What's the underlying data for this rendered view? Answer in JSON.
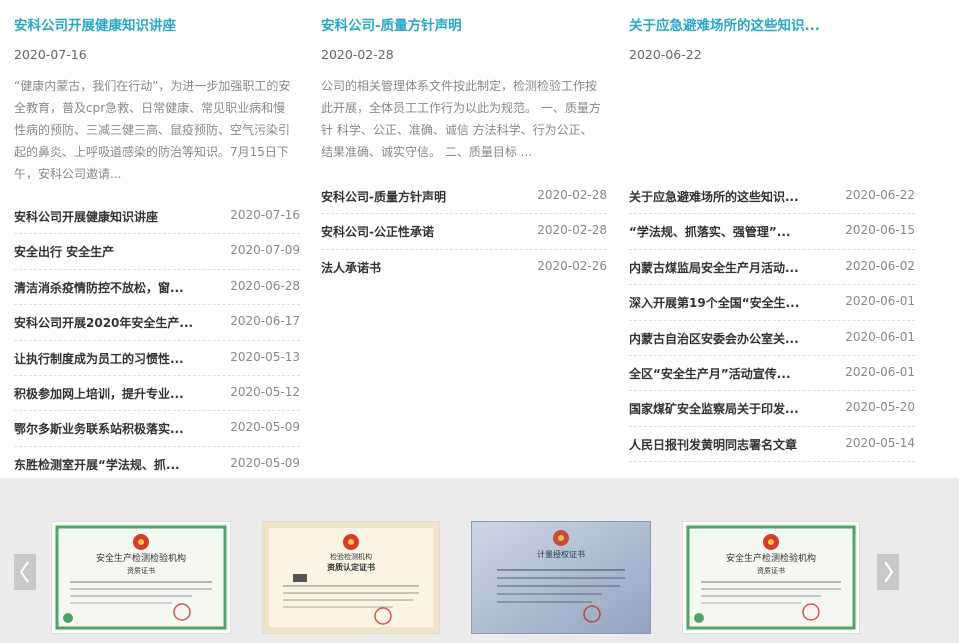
{
  "columns": [
    {
      "featured": {
        "title": "安科公司开展健康知识讲座",
        "date": "2020-07-16",
        "summary": "“健康内蒙古，我们在行动”，为进一步加强职工的安全教育，普及cpr急救、日常健康、常见职业病和慢性病的预防、三减三健三高、鼠疫预防、空气污染引起的鼻炎、上呼吸道感染的防治等知识。7月15日下午，安科公司邀请..."
      },
      "items": [
        {
          "title": "安科公司开展健康知识讲座",
          "date": "2020-07-16"
        },
        {
          "title": "安全出行 安全生产",
          "date": "2020-07-09"
        },
        {
          "title": "清洁消杀疫情防控不放松，窗...",
          "date": "2020-06-28"
        },
        {
          "title": "安科公司开展2020年安全生产...",
          "date": "2020-06-17"
        },
        {
          "title": "让执行制度成为员工的习惯性...",
          "date": "2020-05-13"
        },
        {
          "title": "积极参加网上培训，提升专业...",
          "date": "2020-05-12"
        },
        {
          "title": "鄂尔多斯业务联系站积极落实...",
          "date": "2020-05-09"
        },
        {
          "title": "东胜检测室开展“学法规、抓...",
          "date": "2020-05-09"
        }
      ]
    },
    {
      "featured": {
        "title": "安科公司-质量方针声明",
        "date": "2020-02-28",
        "summary": "公司的相关管理体系文件按此制定，检测检验工作按此开展，全体员工工作行为以此为规范。 一、质量方针 科学、公正、准确、诚信 方法科学、行为公正、结果准确、诚实守信。 二、质量目标 ..."
      },
      "items": [
        {
          "title": "安科公司-质量方针声明",
          "date": "2020-02-28"
        },
        {
          "title": "安科公司-公正性承诺",
          "date": "2020-02-28"
        },
        {
          "title": "法人承诺书",
          "date": "2020-02-26"
        }
      ]
    },
    {
      "featured": {
        "title": "关于应急避难场所的这些知识...",
        "date": "2020-06-22",
        "summary": ""
      },
      "items": [
        {
          "title": "关于应急避难场所的这些知识...",
          "date": "2020-06-22"
        },
        {
          "title": "“学法规、抓落实、强管理”...",
          "date": "2020-06-15"
        },
        {
          "title": "内蒙古煤监局安全生产月活动...",
          "date": "2020-06-02"
        },
        {
          "title": "深入开展第19个全国“安全生...",
          "date": "2020-06-01"
        },
        {
          "title": "内蒙古自治区安委会办公室关...",
          "date": "2020-06-01"
        },
        {
          "title": "全区“安全生产月”活动宣传...",
          "date": "2020-06-01"
        },
        {
          "title": "国家煤矿安全监察局关于印发...",
          "date": "2020-05-20"
        },
        {
          "title": "人民日报刊发黄明同志署名文章",
          "date": "2020-05-14"
        }
      ]
    }
  ],
  "certificates": {
    "prev_icon": "chevron-left-icon",
    "next_icon": "chevron-right-icon",
    "items": [
      {
        "heading": "安全生产检测检验机构",
        "subheading": "资质证书",
        "style": "green-border"
      },
      {
        "heading": "检验检测机构",
        "subheading": "资质认定证书",
        "style": "cream"
      },
      {
        "heading": "计量授权证书",
        "subheading": "",
        "style": "blue-photo"
      },
      {
        "heading": "安全生产检测检验机构",
        "subheading": "资质证书",
        "style": "green-border"
      }
    ]
  },
  "colors": {
    "link_accent": "#28a8c8",
    "cert_bar_bg": "#ececec",
    "arrow_bg": "#c9c9c9"
  }
}
